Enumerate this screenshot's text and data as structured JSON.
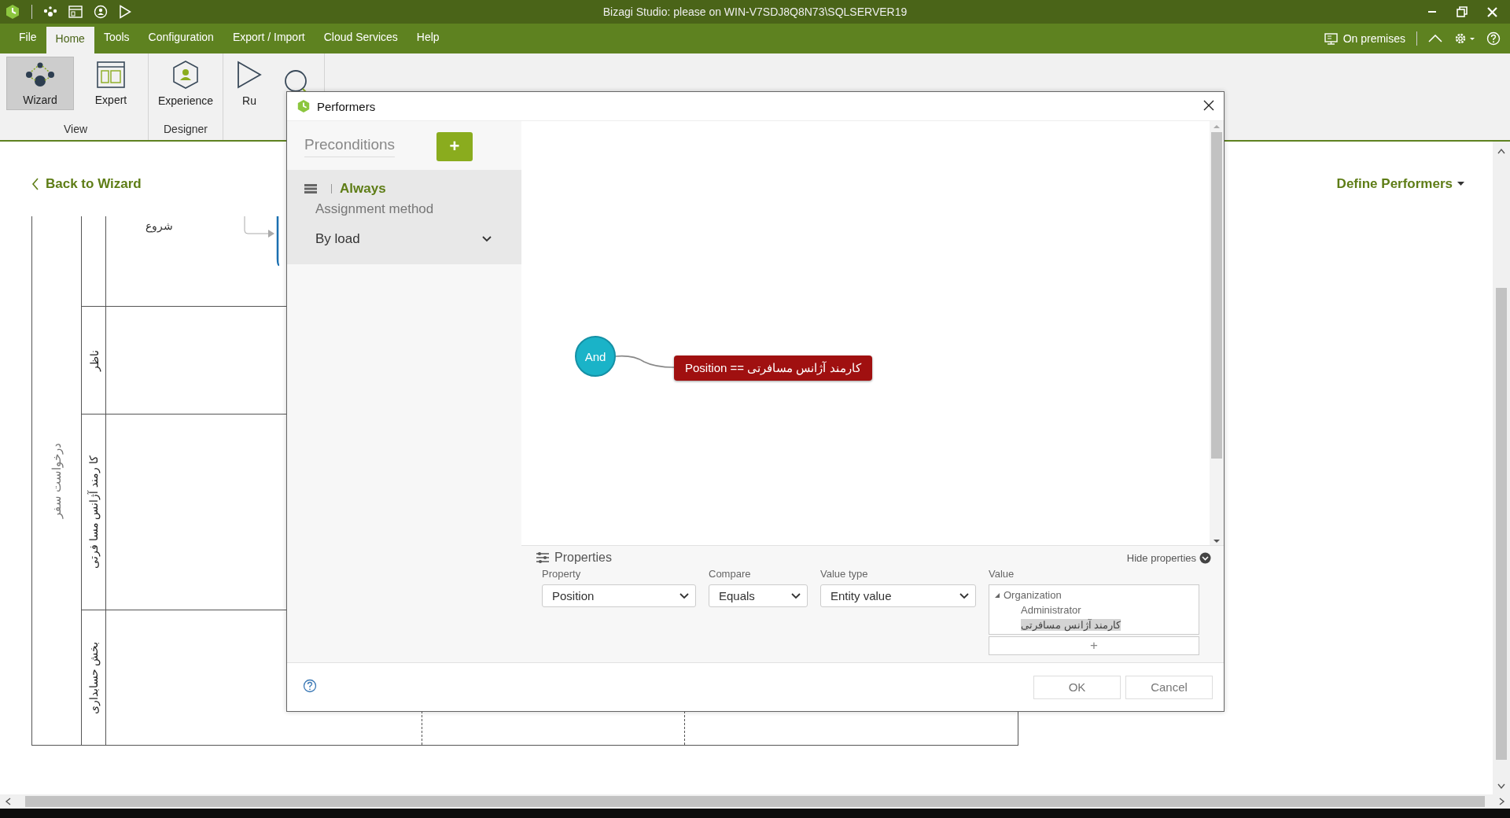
{
  "window": {
    "title": "Bizagi Studio: please  on WIN-V7SDJ8Q8N73\\SQLSERVER19"
  },
  "menu": [
    {
      "label": "File",
      "selected": false
    },
    {
      "label": "Home",
      "selected": true
    },
    {
      "label": "Tools",
      "selected": false
    },
    {
      "label": "Configuration",
      "selected": false
    },
    {
      "label": "Export / Import",
      "selected": false
    },
    {
      "label": "Cloud Services",
      "selected": false
    },
    {
      "label": "Help",
      "selected": false
    }
  ],
  "environment": "On premises",
  "ribbon": [
    {
      "label": "View",
      "buttons": [
        {
          "label": "Wizard",
          "selected": true
        },
        {
          "label": "Expert",
          "selected": false
        }
      ]
    },
    {
      "label": "Designer",
      "buttons": [
        {
          "label": "Experience",
          "selected": false
        }
      ]
    },
    {
      "buttons": [
        {
          "label": "Ru",
          "selected": false
        },
        {
          "selected": false
        }
      ]
    }
  ],
  "back_link": "Back to Wizard",
  "define_menu": "Define Performers",
  "diagram": {
    "pool": "درخواست سفر",
    "start_event": "شروع",
    "lanes": [
      {
        "label": "ناظر"
      },
      {
        "label": "کا رمند آژانس مسا فرتی"
      },
      {
        "label": "بخش حسابداری"
      }
    ]
  },
  "dialog": {
    "title": "Performers",
    "preconditions": {
      "title": "Preconditions",
      "add": "+",
      "items": [
        {
          "name": "Always",
          "caption": "Assignment method",
          "method": "By load",
          "selected": true
        }
      ]
    },
    "canvas": {
      "operator": "And",
      "condition": "Position == کارمند آژانس مسافرتی"
    },
    "properties": {
      "title": "Properties",
      "hide": "Hide properties",
      "fields": [
        {
          "label": "Property",
          "value": "Position"
        },
        {
          "label": "Compare",
          "value": "Equals"
        },
        {
          "label": "Value type",
          "value": "Entity value"
        }
      ],
      "value": {
        "label": "Value",
        "add": "+",
        "tree": [
          {
            "label": "Organization",
            "expanded": true,
            "children": [
              {
                "label": "Administrator",
                "selected": false
              },
              {
                "label": "کارمند آژانس مسافرتی",
                "selected": true
              }
            ]
          }
        ]
      }
    },
    "buttons": [
      "OK",
      "Cancel"
    ]
  }
}
